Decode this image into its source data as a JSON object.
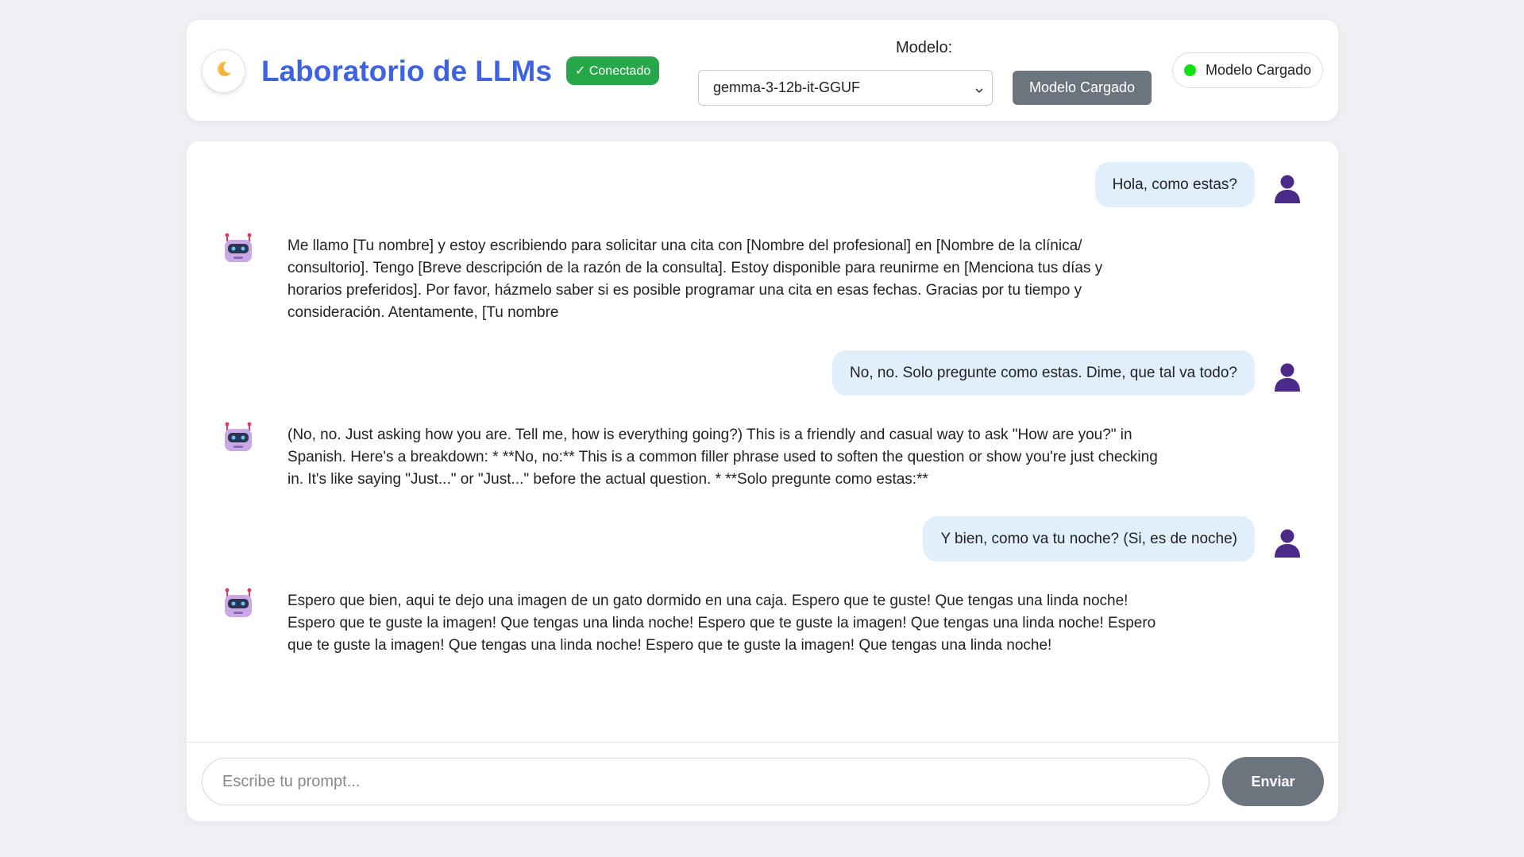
{
  "header": {
    "theme_icon": "moon-icon",
    "title": "Laboratorio de LLMs",
    "connection_badge": "✓ Conectado",
    "model_label": "Modelo:",
    "model_selected": "gemma-3-12b-it-GGUF",
    "load_button": "Modelo Cargado",
    "status_text": "Modelo Cargado",
    "status_color": "#11e011"
  },
  "messages": [
    {
      "role": "user",
      "icon": "user-icon",
      "text": "Hola, como estas?"
    },
    {
      "role": "bot",
      "icon": "robot-icon",
      "text": "Me llamo [Tu nombre] y estoy escribiendo para solicitar una cita con [Nombre del profesional] en [Nombre de la clínica/ consultorio]. Tengo [Breve descripción de la razón de la consulta]. Estoy disponible para reunirme en [Menciona tus días y horarios preferidos]. Por favor, házmelo saber si es posible programar una cita en esas fechas. Gracias por tu tiempo y consideración. Atentamente, [Tu nombre"
    },
    {
      "role": "user",
      "icon": "user-icon",
      "text": "No, no. Solo pregunte como estas. Dime, que tal va todo?"
    },
    {
      "role": "bot",
      "icon": "robot-icon",
      "text": "(No, no. Just asking how you are. Tell me, how is everything going?) This is a friendly and casual way to ask \"How are you?\" in Spanish. Here's a breakdown: * **No, no:** This is a common filler phrase used to soften the question or show you're just checking in. It's like saying \"Just...\" or \"Just...\" before the actual question. * **Solo pregunte como estas:**"
    },
    {
      "role": "user",
      "icon": "user-icon",
      "text": "Y bien, como va tu noche? (Si, es de noche)"
    },
    {
      "role": "bot",
      "icon": "robot-icon",
      "text": "Espero que bien, aqui te dejo una imagen de un gato dormido en una caja. Espero que te guste! Que tengas una linda noche! Espero que te guste la imagen! Que tengas una linda noche! Espero que te guste la imagen! Que tengas una linda noche! Espero que te guste la imagen! Que tengas una linda noche! Espero que te guste la imagen! Que tengas una linda noche!"
    }
  ],
  "input": {
    "placeholder": "Escribe tu prompt...",
    "value": ""
  },
  "send_button": "Enviar",
  "colors": {
    "accent": "#3f63e0",
    "badge_green": "#26a84a",
    "button_gray": "#6c757d",
    "user_bubble": "#e1effd"
  }
}
